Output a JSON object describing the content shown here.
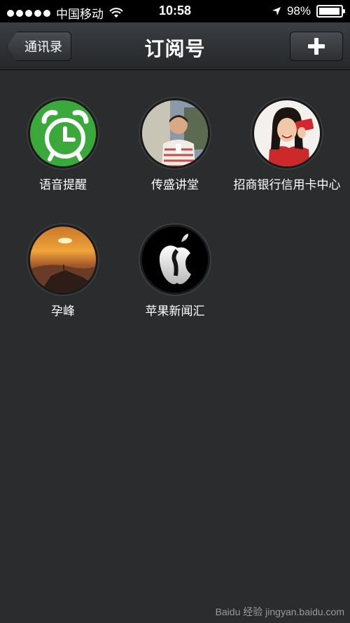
{
  "status_bar": {
    "carrier": "中国移动",
    "time": "10:58",
    "battery_percent": "98%",
    "battery_level": 0.98
  },
  "nav": {
    "back_label": "通讯录",
    "title": "订阅号",
    "add_icon": "plus-icon"
  },
  "subscriptions": [
    {
      "name": "语音提醒",
      "icon": "alarm-clock-icon",
      "color": "#3aa83a"
    },
    {
      "name": "传盛讲堂",
      "icon": "person-photo"
    },
    {
      "name": "招商银行信用卡中心",
      "icon": "woman-card-photo"
    },
    {
      "name": "孕峰",
      "icon": "sunset-mountain-photo"
    },
    {
      "name": "苹果新闻汇",
      "icon": "apple-logo-icon"
    }
  ],
  "watermark": "Baidu 经验 jingyan.baidu.com"
}
